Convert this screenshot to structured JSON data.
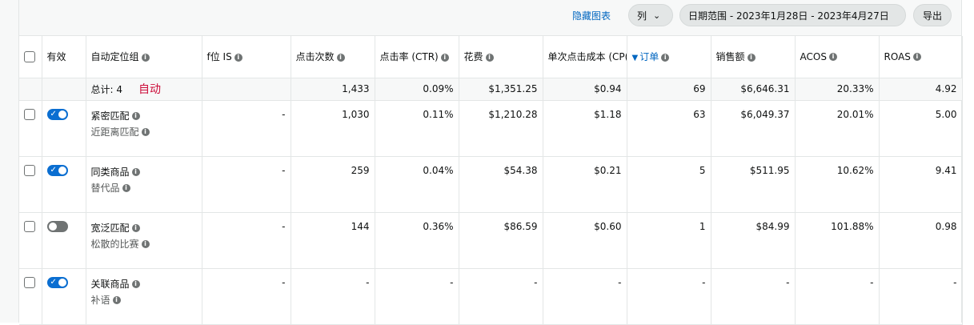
{
  "toolbar": {
    "hide_chart": "隐藏图表",
    "columns": "列",
    "date_range": "日期范围 - 2023年1月28日 - 2023年4月27日",
    "export": "导出"
  },
  "columns": {
    "active": "有效",
    "group": "自动定位组",
    "is": "f位 IS",
    "clicks": "点击次数",
    "ctr": "点击率 (CTR)",
    "spend": "花费",
    "cpc": "单次点击成本 (CP(",
    "orders": "订单",
    "sales": "销售额",
    "acos": "ACOS",
    "roas": "ROAS"
  },
  "total": {
    "label": "总计: 4",
    "annotation": "自动",
    "clicks": "1,433",
    "ctr": "0.09%",
    "spend": "$1,351.25",
    "cpc": "$0.94",
    "orders": "69",
    "sales": "$6,646.31",
    "acos": "20.33%",
    "roas": "4.92"
  },
  "rows": [
    {
      "name": "紧密匹配",
      "sub": "近距离匹配",
      "enabled": true,
      "is": "-",
      "clicks": "1,030",
      "ctr": "0.11%",
      "spend": "$1,210.28",
      "cpc": "$1.18",
      "orders": "63",
      "sales": "$6,049.37",
      "acos": "20.01%",
      "roas": "5.00"
    },
    {
      "name": "同类商品",
      "sub": "替代品",
      "enabled": true,
      "is": "-",
      "clicks": "259",
      "ctr": "0.04%",
      "spend": "$54.38",
      "cpc": "$0.21",
      "orders": "5",
      "sales": "$511.95",
      "acos": "10.62%",
      "roas": "9.41"
    },
    {
      "name": "宽泛匹配",
      "sub": "松散的比赛",
      "enabled": false,
      "is": "-",
      "clicks": "144",
      "ctr": "0.36%",
      "spend": "$86.59",
      "cpc": "$0.60",
      "orders": "1",
      "sales": "$84.99",
      "acos": "101.88%",
      "roas": "0.98"
    },
    {
      "name": "关联商品",
      "sub": "补语",
      "enabled": true,
      "is": "-",
      "clicks": "-",
      "ctr": "-",
      "spend": "-",
      "cpc": "-",
      "orders": "-",
      "sales": "-",
      "acos": "-",
      "roas": "-"
    }
  ]
}
